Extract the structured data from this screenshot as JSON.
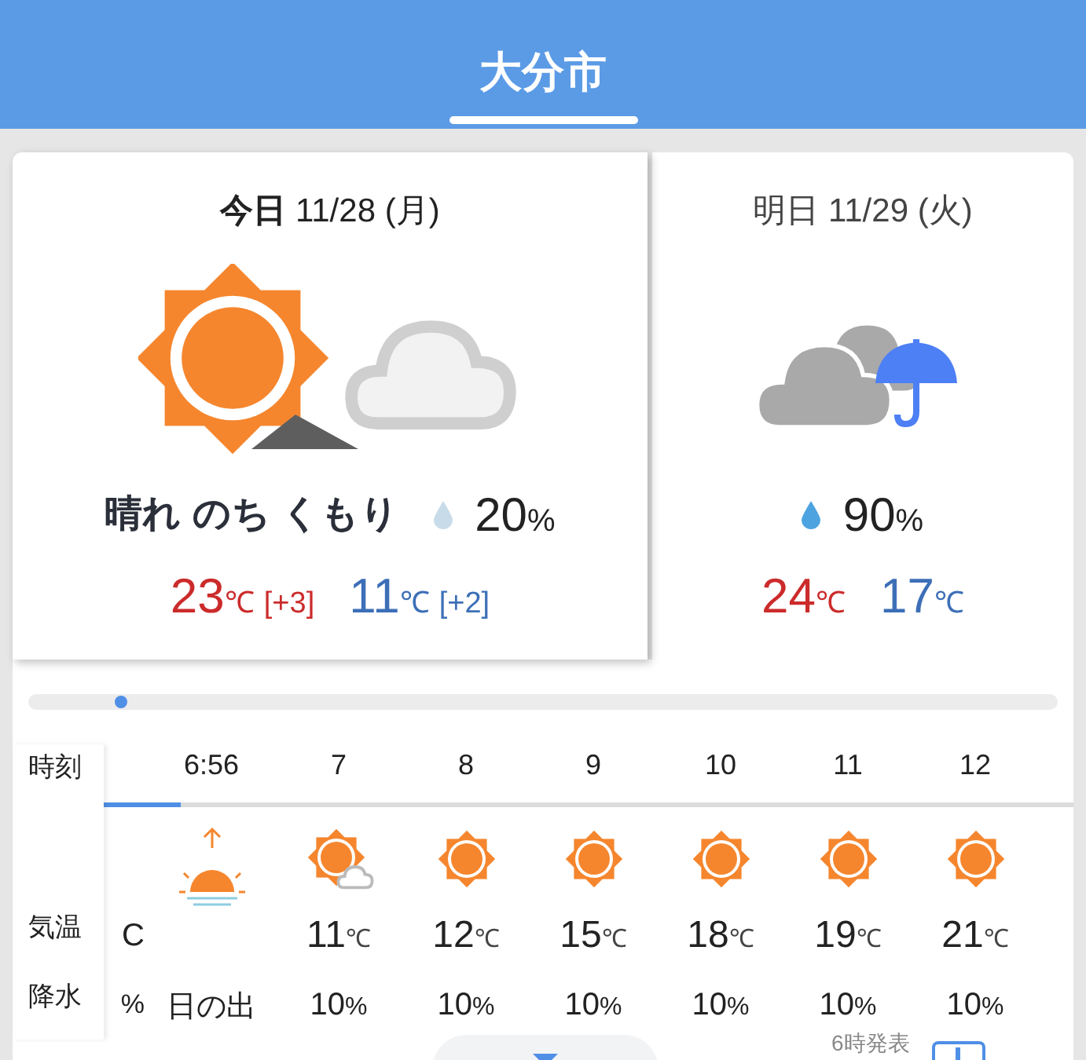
{
  "header": {
    "title": "大分市"
  },
  "days": [
    {
      "label": "今日",
      "date": "11/28",
      "weekday": "(月)",
      "selected": true,
      "kind": "sun_then_cloud",
      "weather": "晴れ のち くもり",
      "rain": "20",
      "rain_unit": "%",
      "high": "23",
      "low": "11",
      "unit": "℃",
      "high_diff": "[+3]",
      "low_diff": "[+2]"
    },
    {
      "label": "明日",
      "date": "11/29",
      "weekday": "(火)",
      "selected": false,
      "kind": "cloud_rain",
      "rain": "90",
      "rain_unit": "%",
      "high": "24",
      "low": "17",
      "unit": "℃"
    }
  ],
  "scroll_slider": {
    "level": 0.09
  },
  "hourly": {
    "labels": [
      "時刻",
      "気温",
      "降水"
    ],
    "progress": {
      "level": 0.08
    },
    "columns": [
      {
        "kind": "partial",
        "temp_unit": "C",
        "rain": "%"
      },
      {
        "kind": "sunrise",
        "time": "6:56",
        "rain": "日の出"
      },
      {
        "kind": "sun_cloud",
        "time": "7",
        "temp": "11",
        "temp_unit": "℃",
        "rain": "10",
        "rain_unit": "%"
      },
      {
        "kind": "sun",
        "time": "8",
        "temp": "12",
        "temp_unit": "℃",
        "rain": "10",
        "rain_unit": "%"
      },
      {
        "kind": "sun",
        "time": "9",
        "temp": "15",
        "temp_unit": "℃",
        "rain": "10",
        "rain_unit": "%"
      },
      {
        "kind": "sun",
        "time": "10",
        "temp": "18",
        "temp_unit": "℃",
        "rain": "10",
        "rain_unit": "%"
      },
      {
        "kind": "sun",
        "time": "11",
        "temp": "19",
        "temp_unit": "℃",
        "rain": "10",
        "rain_unit": "%"
      },
      {
        "kind": "sun",
        "time": "12",
        "temp": "21",
        "temp_unit": "℃",
        "rain": "10",
        "rain_unit": "%"
      }
    ]
  },
  "footer": {
    "issued": "6時発表"
  }
}
